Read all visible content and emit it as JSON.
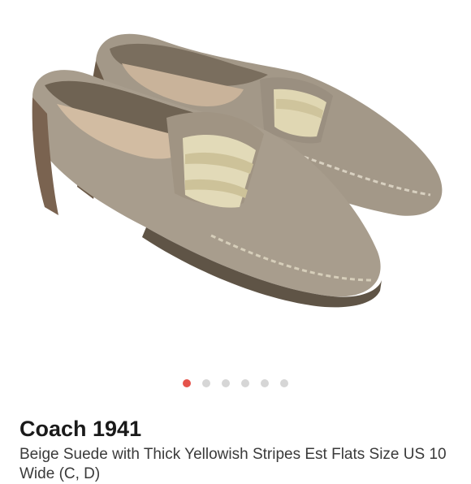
{
  "listing": {
    "brand": "Coach 1941",
    "title": "Beige Suede with Thick Yellowish Stripes Est Flats Size US 10 Wide (C, D)"
  },
  "image_carousel": {
    "total": 6,
    "active_index": 0,
    "image_icon": "loafer-shoes-photo"
  },
  "colors": {
    "active_dot": "#e5534b",
    "inactive_dot": "#d6d6d6",
    "suede": "#a4998a",
    "stripe": "#e2dab8"
  }
}
